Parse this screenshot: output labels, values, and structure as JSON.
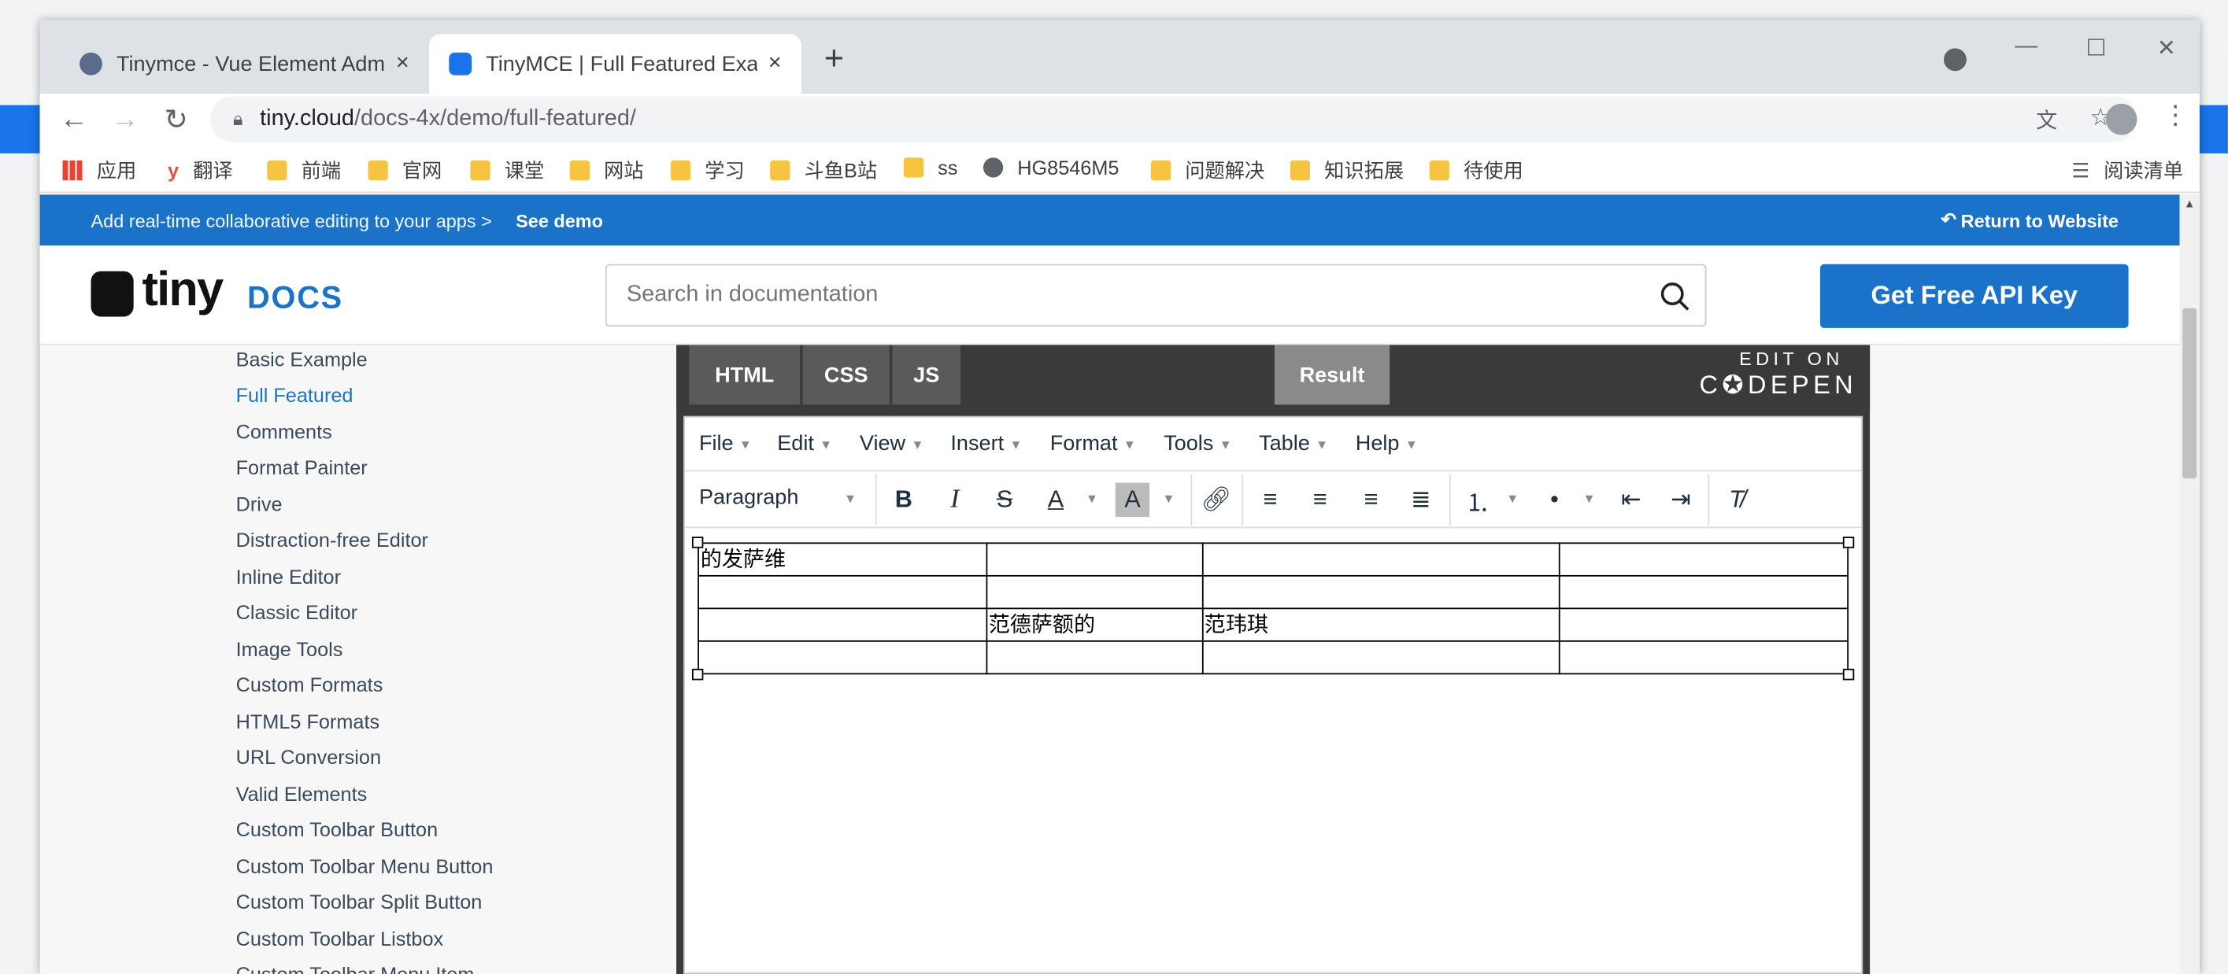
{
  "browser": {
    "tabs": [
      {
        "title": "Tinymce - Vue Element Admin",
        "close": "×"
      },
      {
        "title": "TinyMCE | Full Featured Examp",
        "close": "×"
      }
    ],
    "new_tab": "+",
    "window_controls": {
      "minimize": "—",
      "maximize": "☐",
      "close": "✕"
    },
    "address": {
      "host": "tiny.cloud",
      "path": "/docs-4x/demo/full-featured/"
    },
    "bookmarks": [
      "应用",
      "翻译",
      "前端",
      "官网",
      "课堂",
      "网站",
      "学习",
      "斗鱼B站",
      "ss",
      "HG8546M5",
      "问题解决",
      "知识拓展",
      "待使用"
    ],
    "reading_list": "阅读清单"
  },
  "promo": {
    "text": "Add real-time collaborative editing to your apps > ",
    "link": "See demo",
    "return": "Return to Website"
  },
  "header": {
    "logo": "tiny",
    "docs": "DOCS",
    "search_placeholder": "Search in documentation",
    "api_button": "Get Free API Key"
  },
  "sidebar": {
    "items": [
      "Basic Example",
      "Full Featured",
      "Comments",
      "Format Painter",
      "Drive",
      "Distraction-free Editor",
      "Inline Editor",
      "Classic Editor",
      "Image Tools",
      "Custom Formats",
      "HTML5 Formats",
      "URL Conversion",
      "Valid Elements",
      "Custom Toolbar Button",
      "Custom Toolbar Menu Button",
      "Custom Toolbar Split Button",
      "Custom Toolbar Listbox",
      "Custom Toolbar Menu Item"
    ],
    "current_index": 1
  },
  "codepen": {
    "tabs": [
      "HTML",
      "CSS",
      "JS"
    ],
    "result": "Result",
    "edit_on": "EDIT ON",
    "brand": "C✪DEPEN"
  },
  "editor": {
    "menus": [
      "File",
      "Edit",
      "View",
      "Insert",
      "Format",
      "Tools",
      "Table",
      "Help"
    ],
    "block_format": "Paragraph",
    "table": [
      [
        "的发萨维",
        "",
        "",
        ""
      ],
      [
        "",
        "",
        "",
        ""
      ],
      [
        "",
        "范德萨额的",
        "范玮琪",
        ""
      ],
      [
        "",
        "",
        "",
        ""
      ]
    ]
  },
  "colors": {
    "brand_blue": "#1a73c8",
    "codepen_dark": "#3a3a3a",
    "sidebar_bg": "#f7f7f8"
  }
}
